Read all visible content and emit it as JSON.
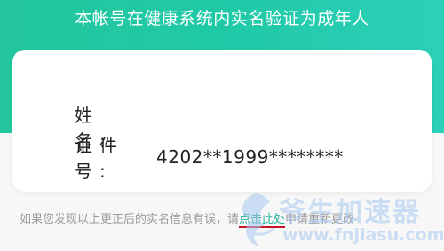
{
  "header": {
    "title": "本帐号在健康系统内实名验证为成年人"
  },
  "card": {
    "name_label": "姓　名:",
    "name_value": "",
    "id_label": "证件号:",
    "id_value": "4202**1999********"
  },
  "footer": {
    "prefix": "如果您发现以上更正后的实名信息有误，请",
    "link": "点击此处",
    "suffix": "申请重新更改"
  },
  "watermark": {
    "brand": "爷生加速器",
    "url": "www.fnjiasu.com"
  },
  "colors": {
    "header_gradient_start": "#23c69d",
    "header_gradient_end": "#2dcfb9",
    "link": "#22b39a",
    "link_underline": "#c8142a"
  }
}
